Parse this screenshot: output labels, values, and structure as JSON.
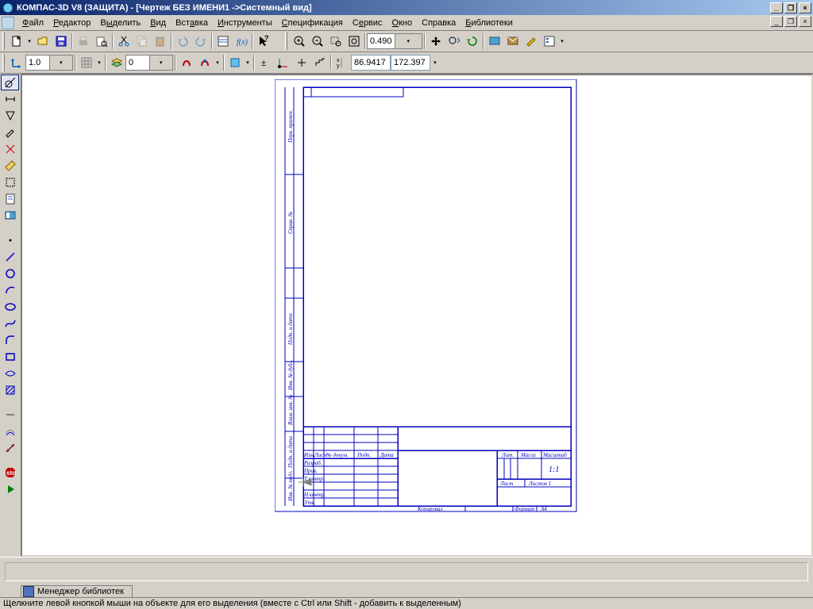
{
  "title": "КОМПАС-3D V8 (ЗАЩИТА) - [Чертеж БЕЗ ИМЕНИ1 ->Системный вид]",
  "menu": {
    "file": "Файл",
    "edit": "Редактор",
    "select": "Выделить",
    "view": "Вид",
    "insert": "Вставка",
    "tools": "Инструменты",
    "spec": "Спецификация",
    "service": "Сервис",
    "window": "Окно",
    "help": "Справка",
    "libs": "Библиотеки"
  },
  "combo_line": "1.0",
  "combo_layer": "0",
  "zoom": "0.490",
  "coord_x": "86.9417",
  "coord_y": "172.397",
  "libtab": "Менеджер библиотек",
  "status": "Щелкните левой кнопкой мыши на объекте для его выделения (вместе с Ctrl или Shift - добавить к выделенным)",
  "stamp": {
    "izm": "Изм.",
    "list": "Лист",
    "ndok": "№ докум.",
    "podp": "Подп.",
    "data": "Дата",
    "razrab": "Разраб.",
    "prov": "Пров.",
    "tkontr": "Т.контр.",
    "nkontr": "Н.контр.",
    "utv": "Утв.",
    "lit": "Лит.",
    "massa": "Масса",
    "mash": "Масштаб",
    "scale": "1:1",
    "list2": "Лист",
    "listov": "Листов 1",
    "kopir": "Копировал",
    "format": "Формат",
    "a4": "А4"
  },
  "side_labels": {
    "a": "Перв. примен.",
    "b": "Справ. №",
    "c": "Подп. и дата",
    "d": "Инв. № дубл.",
    "e": "Взам. инв. №",
    "f": "Подп. и дата",
    "g": "Инв. № подл."
  }
}
